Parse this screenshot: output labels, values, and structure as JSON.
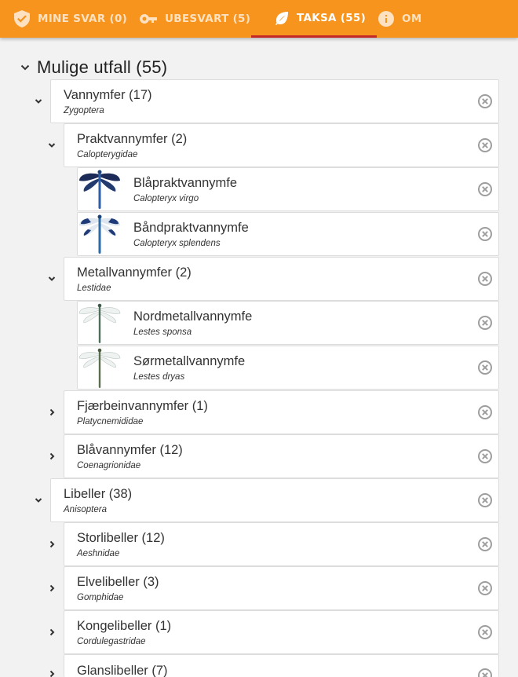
{
  "nav": {
    "tabs": [
      {
        "label": "MINE SVAR (0)",
        "icon": "check-shield-icon"
      },
      {
        "label": "UBESVART (5)",
        "icon": "key-icon"
      },
      {
        "label": "TAKSA (55)",
        "icon": "leaf-icon"
      },
      {
        "label": "OM",
        "icon": "info-icon"
      }
    ],
    "active_tab": "TAKSA (55)"
  },
  "section": {
    "title": "Mulige utfall (55)"
  },
  "tree": [
    {
      "name": "Vannymfer (17)",
      "sci": "Zygoptera",
      "expanded": true
    },
    {
      "name": "Praktvannymfer (2)",
      "sci": "Calopterygidae",
      "expanded": true
    },
    {
      "name": "Blåpraktvannymfe",
      "sci": "Calopteryx virgo"
    },
    {
      "name": "Båndpraktvannymfe",
      "sci": "Calopteryx splendens"
    },
    {
      "name": "Metallvannymfer (2)",
      "sci": "Lestidae",
      "expanded": true
    },
    {
      "name": "Nordmetallvannymfe",
      "sci": "Lestes sponsa"
    },
    {
      "name": "Sørmetallvannymfe",
      "sci": "Lestes dryas"
    },
    {
      "name": "Fjærbeinvannymfer (1)",
      "sci": "Platycnemididae",
      "expanded": false
    },
    {
      "name": "Blåvannymfer (12)",
      "sci": "Coenagrionidae",
      "expanded": false
    },
    {
      "name": "Libeller (38)",
      "sci": "Anisoptera",
      "expanded": true
    },
    {
      "name": "Storlibeller (12)",
      "sci": "Aeshnidae",
      "expanded": false
    },
    {
      "name": "Elvelibeller (3)",
      "sci": "Gomphidae",
      "expanded": false
    },
    {
      "name": "Kongelibeller (1)",
      "sci": "Cordulegastridae",
      "expanded": false
    },
    {
      "name": "Glanslibeller (7)",
      "sci": "",
      "expanded": false
    }
  ],
  "colors": {
    "nav_bg": "#f7941d",
    "active_indicator": "#c62828",
    "page_bg": "#f2f2f2",
    "card_bg": "#ffffff",
    "remove_icon": "#9e9e9e"
  }
}
